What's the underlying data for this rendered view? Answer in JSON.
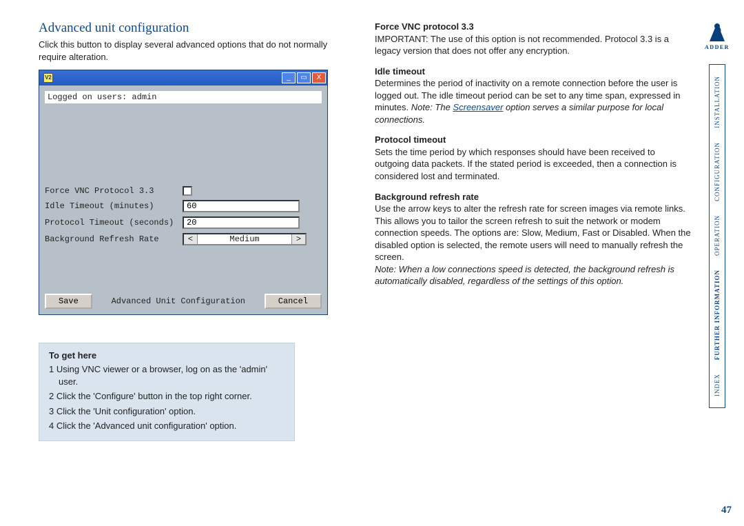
{
  "title": "Advanced unit configuration",
  "intro": "Click this button to display several advanced options that do not normally require alteration.",
  "window": {
    "icon_label": "V2",
    "logged_line": "Logged on users: admin",
    "rows": {
      "force_label": "Force VNC Protocol 3.3",
      "idle_label": "Idle Timeout (minutes)",
      "idle_value": "60",
      "proto_label": "Protocol Timeout (seconds)",
      "proto_value": "20",
      "refresh_label": "Background Refresh Rate",
      "refresh_value": "Medium"
    },
    "save": "Save",
    "center_title": "Advanced Unit Configuration",
    "cancel": "Cancel"
  },
  "togethere": {
    "heading": "To get here",
    "steps": [
      "1  Using VNC viewer or a browser, log on as the 'admin' user.",
      "2  Click the 'Configure' button in the top right corner.",
      "3  Click the 'Unit configuration' option.",
      "4  Click the 'Advanced unit configuration' option."
    ]
  },
  "defs": {
    "force_h": "Force VNC protocol 3.3",
    "force_b": "IMPORTANT: The use of this option is not recommended. Protocol 3.3 is a legacy version that does not offer any encryption.",
    "idle_h": "Idle timeout",
    "idle_b1": "Determines the period of inactivity on a remote connection before the user is logged out. The idle timeout period can be set to any time span, expressed in minutes. ",
    "idle_note_prefix": "Note: The ",
    "idle_note_link": "Screensaver",
    "idle_note_suffix": " option serves a similar purpose for local connections.",
    "proto_h": "Protocol timeout",
    "proto_b": "Sets the time period by which responses should have been received to outgoing data packets. If the stated period is exceeded, then a connection is considered lost and terminated.",
    "refresh_h": "Background refresh rate",
    "refresh_b": "Use the arrow keys to alter the refresh rate for screen images via remote links. This allows you to tailor the screen refresh to suit the network or modem connection speeds. The options are: Slow, Medium, Fast or Disabled. When the disabled option is selected, the remote users will need to manually refresh the screen.",
    "refresh_note": "Note: When a low connections speed is detected, the background refresh is automatically disabled, regardless of the settings of this option."
  },
  "logo_text": "ADDER",
  "nav": {
    "installation": "INSTALLATION",
    "configuration": "CONFIGURATION",
    "operation": "OPERATION",
    "further": "FURTHER\nINFORMATION",
    "index": "INDEX"
  },
  "page_number": "47"
}
